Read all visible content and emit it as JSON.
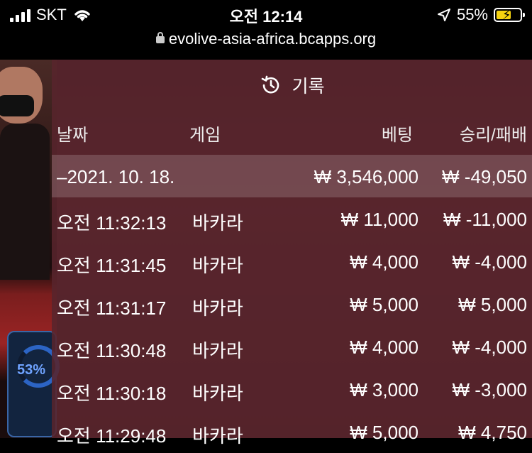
{
  "status_bar": {
    "carrier": "SKT",
    "time": "오전 12:14",
    "battery": "55%"
  },
  "url_bar": {
    "url": "evolive-asia-africa.bcapps.org"
  },
  "game": {
    "progress_label": "53%"
  },
  "history": {
    "title": "기록",
    "columns": {
      "date": "날짜",
      "game": "게임",
      "bet": "베팅",
      "win_loss": "승리/패배"
    },
    "date_group": {
      "date": "–2021. 10. 18.",
      "bet": "₩ 3,546,000",
      "win_loss": "₩ -49,050"
    },
    "rows": [
      {
        "time": "오전 11:32:13",
        "game": "바카라",
        "bet": "₩ 11,000",
        "win_loss": "₩ -11,000"
      },
      {
        "time": "오전 11:31:45",
        "game": "바카라",
        "bet": "₩ 4,000",
        "win_loss": "₩ -4,000"
      },
      {
        "time": "오전 11:31:17",
        "game": "바카라",
        "bet": "₩ 5,000",
        "win_loss": "₩ 5,000"
      },
      {
        "time": "오전 11:30:48",
        "game": "바카라",
        "bet": "₩ 4,000",
        "win_loss": "₩ -4,000"
      },
      {
        "time": "오전 11:30:18",
        "game": "바카라",
        "bet": "₩ 3,000",
        "win_loss": "₩ -3,000"
      },
      {
        "time": "오전 11:29:48",
        "game": "바카라",
        "bet": "₩ 5,000",
        "win_loss": "₩ 4,750"
      }
    ]
  }
}
